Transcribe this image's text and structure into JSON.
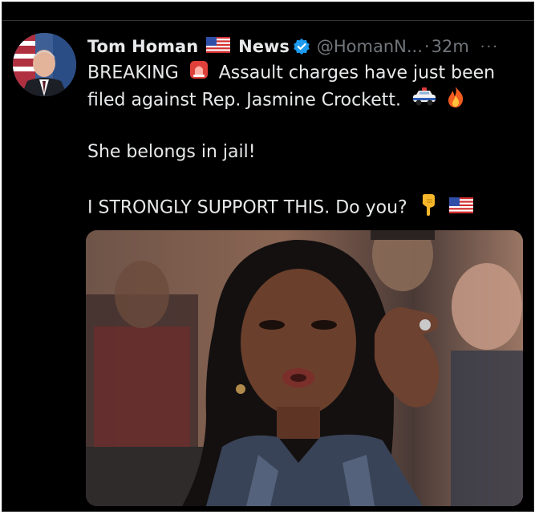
{
  "post": {
    "author_name": "Tom Homan",
    "author_name_suffix": "News",
    "handle": "@HomanN...",
    "separator": "·",
    "time": "32m",
    "more": "···",
    "line1_a": "BREAKING",
    "line1_b": "Assault charges have just been",
    "line2": "filed against Rep. Jasmine Crockett.",
    "line3": "She belongs in jail!",
    "line4": "I STRONGLY SUPPORT THIS. Do you?"
  },
  "icons": {
    "flag": "us-flag-icon",
    "verified": "verified-badge-icon",
    "siren": "police-light-icon",
    "police_car": "police-car-icon",
    "fire": "fire-icon",
    "point_down": "pointing-down-icon"
  },
  "colors": {
    "background": "#000000",
    "text": "#e7e9ea",
    "secondary_text": "#71767b",
    "verified_blue": "#1d9bf0"
  }
}
